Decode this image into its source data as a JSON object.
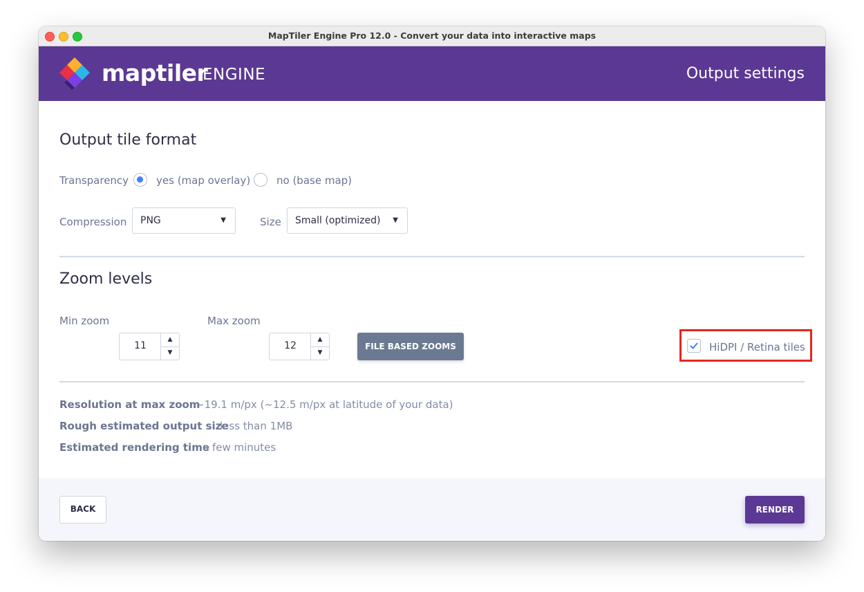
{
  "window": {
    "title": "MapTiler Engine Pro 12.0 - Convert your data into interactive maps"
  },
  "header": {
    "brand": "maptiler",
    "brand_suffix": "ENGINE",
    "page_title": "Output settings"
  },
  "tile_format": {
    "title": "Output tile format",
    "transparency_label": "Transparency",
    "options": [
      {
        "label": "yes (map overlay)",
        "selected": true
      },
      {
        "label": "no (base map)",
        "selected": false
      }
    ],
    "compression_label": "Compression",
    "compression_value": "PNG",
    "size_label": "Size",
    "size_value": "Small (optimized)"
  },
  "zoom": {
    "title": "Zoom levels",
    "min_label": "Min zoom",
    "min_value": "11",
    "max_label": "Max zoom",
    "max_value": "12",
    "file_based_button": "FILE BASED ZOOMS",
    "hidpi_label": "HiDPI / Retina tiles",
    "hidpi_checked": true
  },
  "info": [
    {
      "label": "Resolution at max zoom",
      "value": "~19.1 m/px (~12.5 m/px at latitude of your data)"
    },
    {
      "label": "Rough estimated output size",
      "value": "less than 1MB"
    },
    {
      "label": "Estimated rendering time",
      "value": "a few minutes"
    }
  ],
  "footer": {
    "back_label": "BACK",
    "render_label": "RENDER"
  },
  "colors": {
    "brand_purple": "#5b3894",
    "radio_accent": "#3b82f6",
    "highlight_red": "#e5271c"
  }
}
